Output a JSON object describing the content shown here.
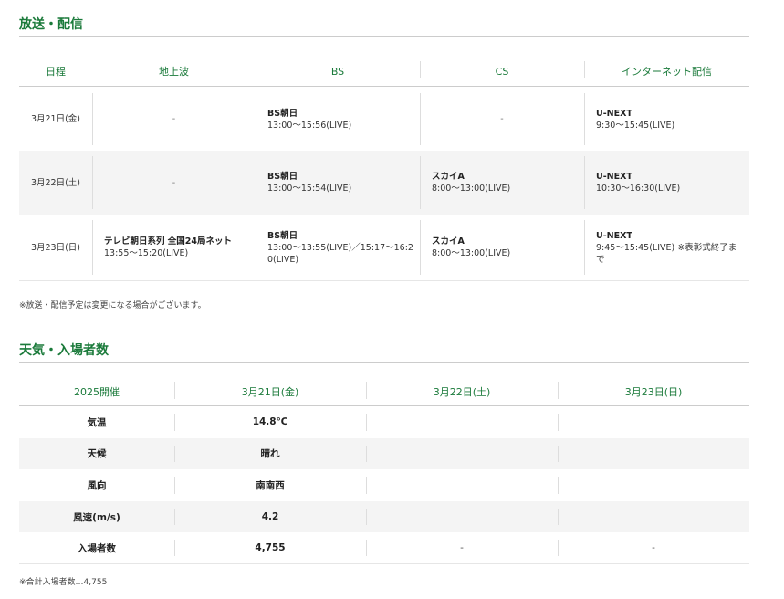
{
  "broadcast": {
    "title": "放送・配信",
    "headers": [
      "日程",
      "地上波",
      "BS",
      "CS",
      "インターネット配信"
    ],
    "rows": [
      {
        "date": "3月21日(金)",
        "terrestrial": "-",
        "bs": {
          "name": "BS朝日",
          "time": "13:00～15:56(LIVE)"
        },
        "cs": "-",
        "net": {
          "name": "U-NEXT",
          "time": "9:30～15:45(LIVE)"
        }
      },
      {
        "date": "3月22日(土)",
        "terrestrial": "-",
        "bs": {
          "name": "BS朝日",
          "time": "13:00～15:54(LIVE)"
        },
        "cs": {
          "name": "スカイA",
          "time": "8:00～13:00(LIVE)"
        },
        "net": {
          "name": "U-NEXT",
          "time": "10:30～16:30(LIVE)"
        }
      },
      {
        "date": "3月23日(日)",
        "terrestrial": {
          "name": "テレビ朝日系列 全国24局ネット",
          "time": "13:55～15:20(LIVE)"
        },
        "bs": {
          "name": "BS朝日",
          "time": "13:00～13:55(LIVE)／15:17～16:20(LIVE)"
        },
        "cs": {
          "name": "スカイA",
          "time": "8:00～13:00(LIVE)"
        },
        "net": {
          "name": "U-NEXT",
          "time": "9:45～15:45(LIVE) ※表彰式終了まで"
        }
      }
    ],
    "note": "※放送・配信予定は変更になる場合がございます。"
  },
  "weather": {
    "title": "天気・入場者数",
    "headers": [
      "2025開催",
      "3月21日(金)",
      "3月22日(土)",
      "3月23日(日)"
    ],
    "rows": [
      {
        "label": "気温",
        "d1": "14.8℃",
        "d2": "",
        "d3": ""
      },
      {
        "label": "天候",
        "d1": "晴れ",
        "d2": "",
        "d3": ""
      },
      {
        "label": "風向",
        "d1": "南南西",
        "d2": "",
        "d3": ""
      },
      {
        "label": "風速(m/s)",
        "d1": "4.2",
        "d2": "",
        "d3": ""
      },
      {
        "label": "入場者数",
        "d1": "4,755",
        "d2": "-",
        "d3": "-"
      }
    ],
    "note": "※合計入場者数…4,755"
  },
  "colors": {
    "accent": "#1a7a3a",
    "alt_row": "#f4f4f4",
    "rule": "#cccccc"
  }
}
